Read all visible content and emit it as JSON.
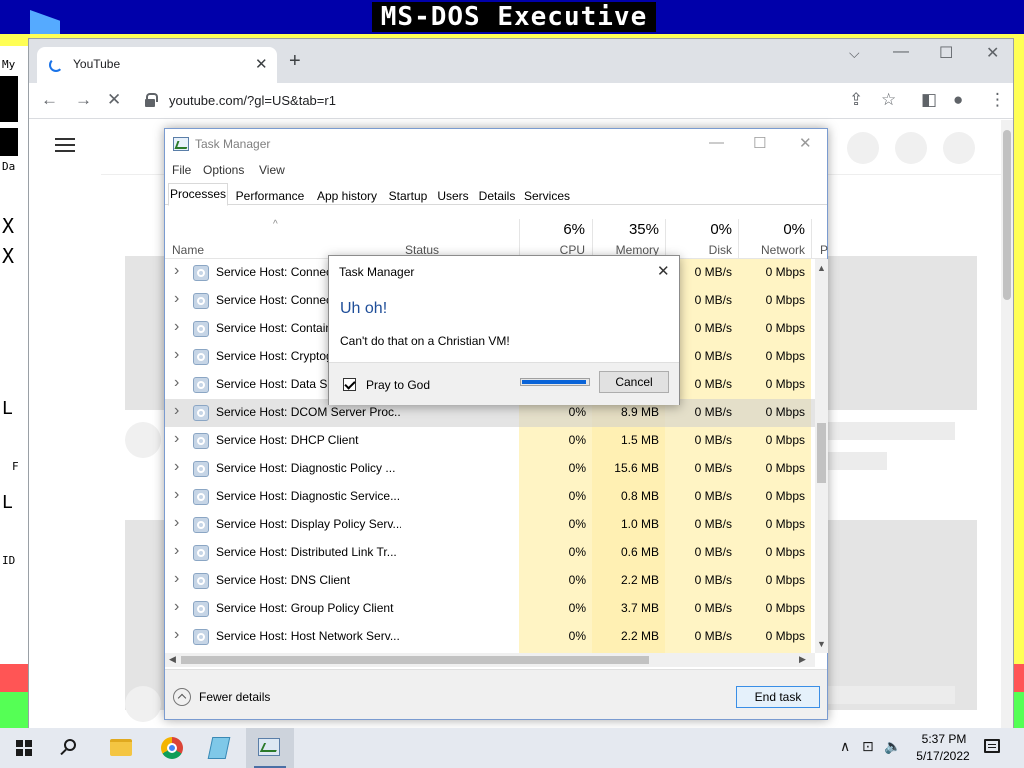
{
  "background": {
    "title": "MS-DOS Executive",
    "fragments": [
      "My",
      "Da",
      "L",
      "F",
      "L",
      "ID",
      "X",
      "X"
    ]
  },
  "browser": {
    "tab_title": "YouTube",
    "tab_close": "✕",
    "new_tab": "+",
    "tab_search": "⌵",
    "minimize": "—",
    "maximize": "☐",
    "close": "✕",
    "back": "←",
    "forward": "→",
    "stop": "✕",
    "url": "youtube.com/?gl=US&tab=r1",
    "share": "⇪",
    "bookmark": "☆",
    "sidepanel": "◧",
    "profile": "●",
    "menu": "⋮"
  },
  "task_manager": {
    "title": "Task Manager",
    "minimize": "—",
    "maximize": "☐",
    "close": "✕",
    "menus": [
      "File",
      "Options",
      "View"
    ],
    "tabs": [
      "Processes",
      "Performance",
      "App history",
      "Startup",
      "Users",
      "Details",
      "Services"
    ],
    "active_tab": "Processes",
    "columns": {
      "name": "Name",
      "status": "Status",
      "cpu": {
        "pct": "6%",
        "label": "CPU"
      },
      "memory": {
        "pct": "35%",
        "label": "Memory"
      },
      "disk": {
        "pct": "0%",
        "label": "Disk"
      },
      "network": {
        "pct": "0%",
        "label": "Network"
      },
      "power": {
        "label": "P"
      }
    },
    "sort_arrow": "^",
    "rows": [
      {
        "name": "Service Host: Connect",
        "cpu": "",
        "memory": "",
        "disk": "0 MB/s",
        "network": "0 Mbps"
      },
      {
        "name": "Service Host: Connect",
        "cpu": "",
        "memory": "",
        "disk": "0 MB/s",
        "network": "0 Mbps"
      },
      {
        "name": "Service Host: Contain",
        "cpu": "",
        "memory": "",
        "disk": "0 MB/s",
        "network": "0 Mbps"
      },
      {
        "name": "Service Host: Cryptog",
        "cpu": "",
        "memory": "",
        "disk": "0 MB/s",
        "network": "0 Mbps"
      },
      {
        "name": "Service Host: Data Sha",
        "cpu": "",
        "memory": "",
        "disk": "0 MB/s",
        "network": "0 Mbps"
      },
      {
        "name": "Service Host: DCOM Server Proc...",
        "cpu": "0%",
        "memory": "8.9 MB",
        "disk": "0 MB/s",
        "network": "0 Mbps"
      },
      {
        "name": "Service Host: DHCP Client",
        "cpu": "0%",
        "memory": "1.5 MB",
        "disk": "0 MB/s",
        "network": "0 Mbps"
      },
      {
        "name": "Service Host: Diagnostic Policy ...",
        "cpu": "0%",
        "memory": "15.6 MB",
        "disk": "0 MB/s",
        "network": "0 Mbps"
      },
      {
        "name": "Service Host: Diagnostic Service...",
        "cpu": "0%",
        "memory": "0.8 MB",
        "disk": "0 MB/s",
        "network": "0 Mbps"
      },
      {
        "name": "Service Host: Display Policy Serv...",
        "cpu": "0%",
        "memory": "1.0 MB",
        "disk": "0 MB/s",
        "network": "0 Mbps"
      },
      {
        "name": "Service Host: Distributed Link Tr...",
        "cpu": "0%",
        "memory": "0.6 MB",
        "disk": "0 MB/s",
        "network": "0 Mbps"
      },
      {
        "name": "Service Host: DNS Client",
        "cpu": "0%",
        "memory": "2.2 MB",
        "disk": "0 MB/s",
        "network": "0 Mbps"
      },
      {
        "name": "Service Host: Group Policy Client",
        "cpu": "0%",
        "memory": "3.7 MB",
        "disk": "0 MB/s",
        "network": "0 Mbps"
      },
      {
        "name": "Service Host: Host Network Serv...",
        "cpu": "0%",
        "memory": "2.2 MB",
        "disk": "0 MB/s",
        "network": "0 Mbps"
      }
    ],
    "selected_row": 5,
    "fewer_details": "Fewer details",
    "end_task": "End task"
  },
  "dialog": {
    "title": "Task Manager",
    "close": "✕",
    "heading": "Uh oh!",
    "message": "Can't do that on a Christian VM!",
    "checkbox_label": "Pray to God",
    "checkbox_checked": true,
    "progress_fraction": 0.97,
    "cancel": "Cancel"
  },
  "taskbar": {
    "tray_chevron": "∧",
    "network": "⊡",
    "volume": "🔈",
    "time": "5:37 PM",
    "date": "5/17/2022"
  },
  "colors": {
    "dos_blue": "#0000aa",
    "tm_highlight": "#fff4c4",
    "accent": "#1a73e8"
  }
}
